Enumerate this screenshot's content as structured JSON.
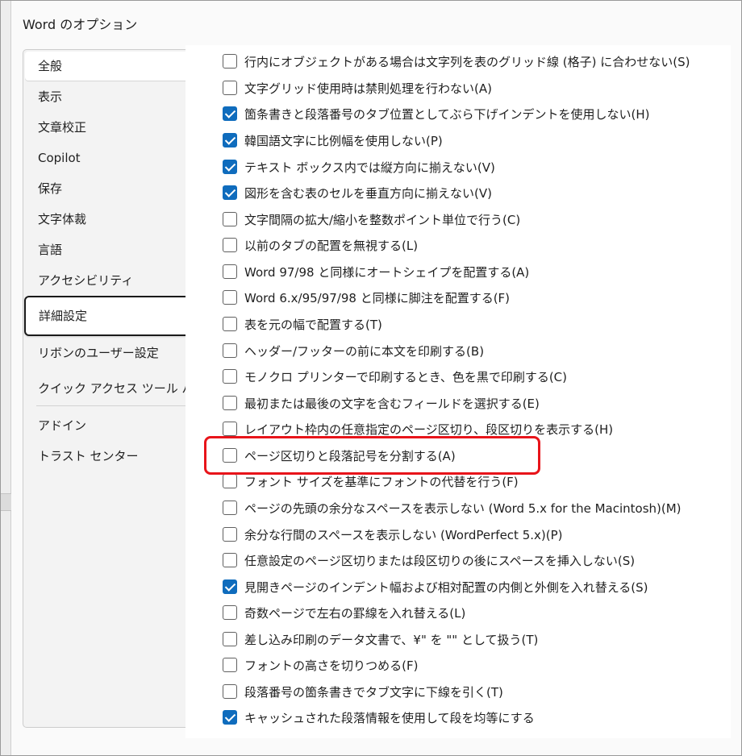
{
  "window": {
    "title": "Word のオプション"
  },
  "sidebar": {
    "items": [
      {
        "label": "全般"
      },
      {
        "label": "表示"
      },
      {
        "label": "文章校正"
      },
      {
        "label": "Copilot"
      },
      {
        "label": "保存"
      },
      {
        "label": "文字体裁"
      },
      {
        "label": "言語"
      },
      {
        "label": "アクセシビリティ"
      },
      {
        "label": "詳細設定"
      },
      {
        "label": "リボンのユーザー設定"
      },
      {
        "label": "クイック アクセス ツール バー"
      },
      {
        "label": "アドイン"
      },
      {
        "label": "トラスト センター"
      }
    ]
  },
  "options": [
    {
      "label": "行内にオブジェクトがある場合は文字列を表のグリッド線 (格子) に合わせない(S)",
      "checked": false
    },
    {
      "label": "文字グリッド使用時は禁則処理を行わない(A)",
      "checked": false
    },
    {
      "label": "箇条書きと段落番号のタブ位置としてぶら下げインデントを使用しない(H)",
      "checked": true
    },
    {
      "label": "韓国語文字に比例幅を使用しない(P)",
      "checked": true
    },
    {
      "label": "テキスト ボックス内では縦方向に揃えない(V)",
      "checked": true
    },
    {
      "label": "図形を含む表のセルを垂直方向に揃えない(V)",
      "checked": true
    },
    {
      "label": "文字間隔の拡大/縮小を整数ポイント単位で行う(C)",
      "checked": false
    },
    {
      "label": "以前のタブの配置を無視する(L)",
      "checked": false
    },
    {
      "label": "Word 97/98 と同様にオートシェイプを配置する(A)",
      "checked": false
    },
    {
      "label": "Word 6.x/95/97/98 と同様に脚注を配置する(F)",
      "checked": false
    },
    {
      "label": "表を元の幅で配置する(T)",
      "checked": false
    },
    {
      "label": "ヘッダー/フッターの前に本文を印刷する(B)",
      "checked": false
    },
    {
      "label": "モノクロ プリンターで印刷するとき、色を黒で印刷する(C)",
      "checked": false
    },
    {
      "label": "最初または最後の文字を含むフィールドを選択する(E)",
      "checked": false
    },
    {
      "label": "レイアウト枠内の任意指定のページ区切り、段区切りを表示する(H)",
      "checked": false
    },
    {
      "label": "ページ区切りと段落記号を分割する(A)",
      "checked": false
    },
    {
      "label": "フォント サイズを基準にフォントの代替を行う(F)",
      "checked": false
    },
    {
      "label": "ページの先頭の余分なスペースを表示しない (Word 5.x for the Macintosh)(M)",
      "checked": false
    },
    {
      "label": "余分な行間のスペースを表示しない (WordPerfect 5.x)(P)",
      "checked": false
    },
    {
      "label": "任意設定のページ区切りまたは段区切りの後にスペースを挿入しない(S)",
      "checked": false
    },
    {
      "label": "見開きページのインデント幅および相対配置の内側と外側を入れ替える(S)",
      "checked": true
    },
    {
      "label": "奇数ページで左右の罫線を入れ替える(L)",
      "checked": false
    },
    {
      "label": "差し込み印刷のデータ文書で、¥\" を \"\" として扱う(T)",
      "checked": false
    },
    {
      "label": "フォントの高さを切りつめる(F)",
      "checked": false
    },
    {
      "label": "段落番号の箇条書きでタブ文字に下線を引く(T)",
      "checked": false
    },
    {
      "label": "キャッシュされた段落情報を使用して段を均等にする",
      "checked": true
    }
  ],
  "colors": {
    "accent": "#0f6cbd",
    "highlight": "#e8141a"
  }
}
